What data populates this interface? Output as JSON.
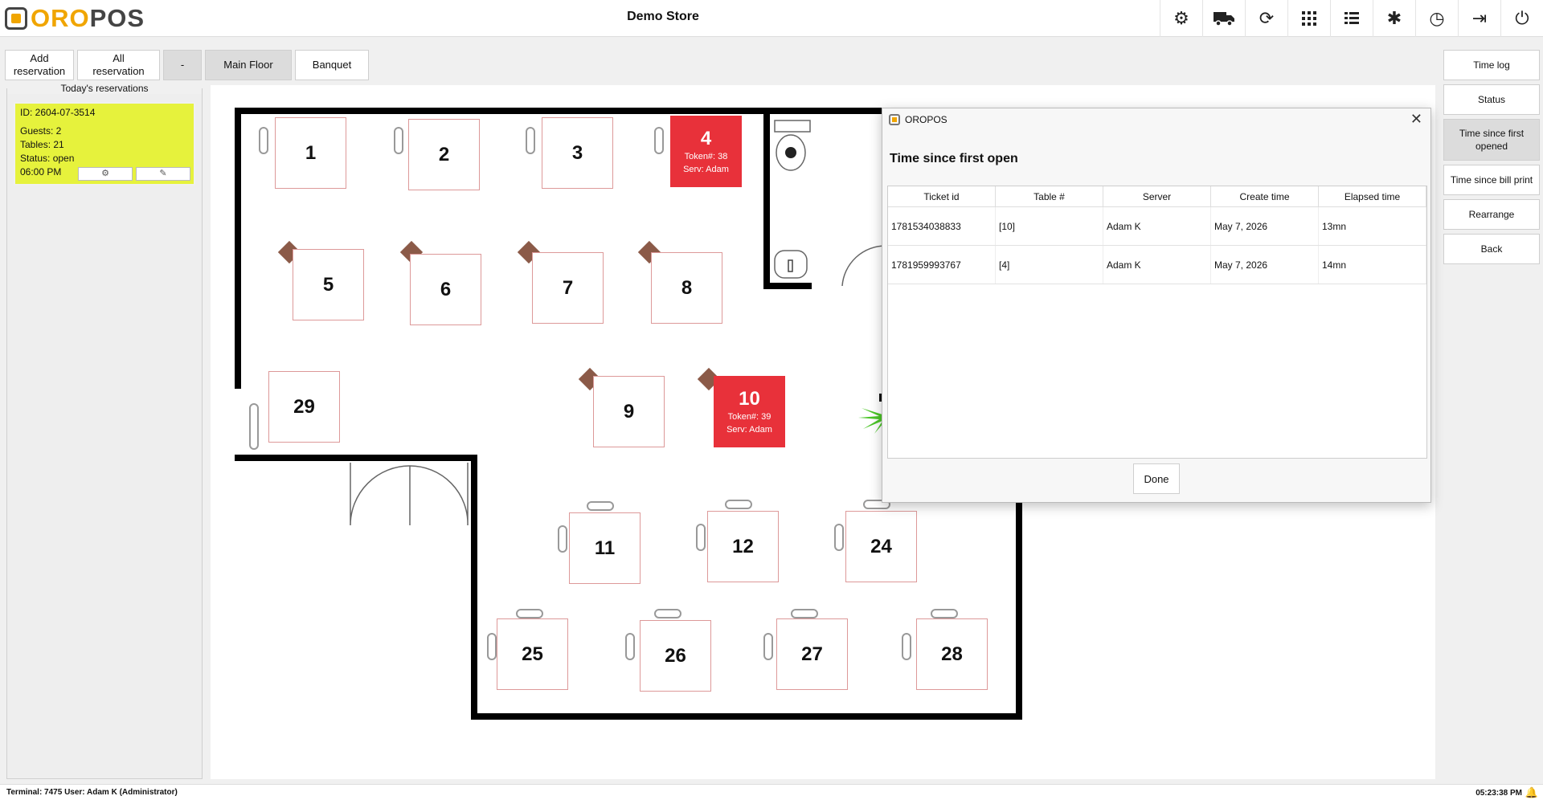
{
  "app": {
    "logo_oro": "ORO",
    "logo_pos": "POS",
    "store_name": "Demo Store"
  },
  "top_icons": [
    "gear-icon",
    "delivery-truck-icon",
    "refresh-icon",
    "grid-icon",
    "list-icon",
    "tools-icon",
    "clock-history-icon",
    "logout-icon",
    "power-icon"
  ],
  "toolbar": {
    "add_reservation": "Add reservation",
    "all_reservation": "All reservation",
    "dash": "-",
    "main_floor": "Main Floor",
    "banquet": "Banquet"
  },
  "reservations": {
    "title": "Today's reservations",
    "card": {
      "id": "ID: 2604-07-3514",
      "guests": "Guests: 2",
      "tables": "Tables: 21",
      "status": "Status: open",
      "time": "06:00 PM"
    }
  },
  "tables": [
    {
      "num": "1"
    },
    {
      "num": "2"
    },
    {
      "num": "3"
    },
    {
      "num": "4",
      "token": "Token#: 38",
      "server": "Serv: Adam"
    },
    {
      "num": "5"
    },
    {
      "num": "6"
    },
    {
      "num": "7"
    },
    {
      "num": "8"
    },
    {
      "num": "29"
    },
    {
      "num": "9"
    },
    {
      "num": "10",
      "token": "Token#: 39",
      "server": "Serv: Adam"
    },
    {
      "num": "11"
    },
    {
      "num": "12"
    },
    {
      "num": "24"
    },
    {
      "num": "25"
    },
    {
      "num": "26"
    },
    {
      "num": "27"
    },
    {
      "num": "28"
    }
  ],
  "right_panel": {
    "time_log": "Time log",
    "status": "Status",
    "time_first_opened": "Time since first opened",
    "time_bill_print": "Time since bill print",
    "rearrange": "Rearrange",
    "back": "Back"
  },
  "dialog": {
    "window_title": "OROPOS",
    "heading": "Time since first open",
    "columns": [
      "Ticket id",
      "Table #",
      "Server",
      "Create time",
      "Elapsed time"
    ],
    "rows": [
      [
        "1781534038833",
        "[10]",
        "Adam K",
        "May 7, 2026",
        "13mn"
      ],
      [
        "1781959993767",
        "[4]",
        "Adam K",
        "May 7, 2026",
        "14mn"
      ]
    ],
    "done": "Done"
  },
  "status_bar": {
    "left": "Terminal: 7475  User: Adam K (Administrator)",
    "time": "05:23:38 PM"
  },
  "colors": {
    "accent": "#f0a500",
    "occupied": "#e8313a",
    "reservation": "#e6f23c"
  }
}
